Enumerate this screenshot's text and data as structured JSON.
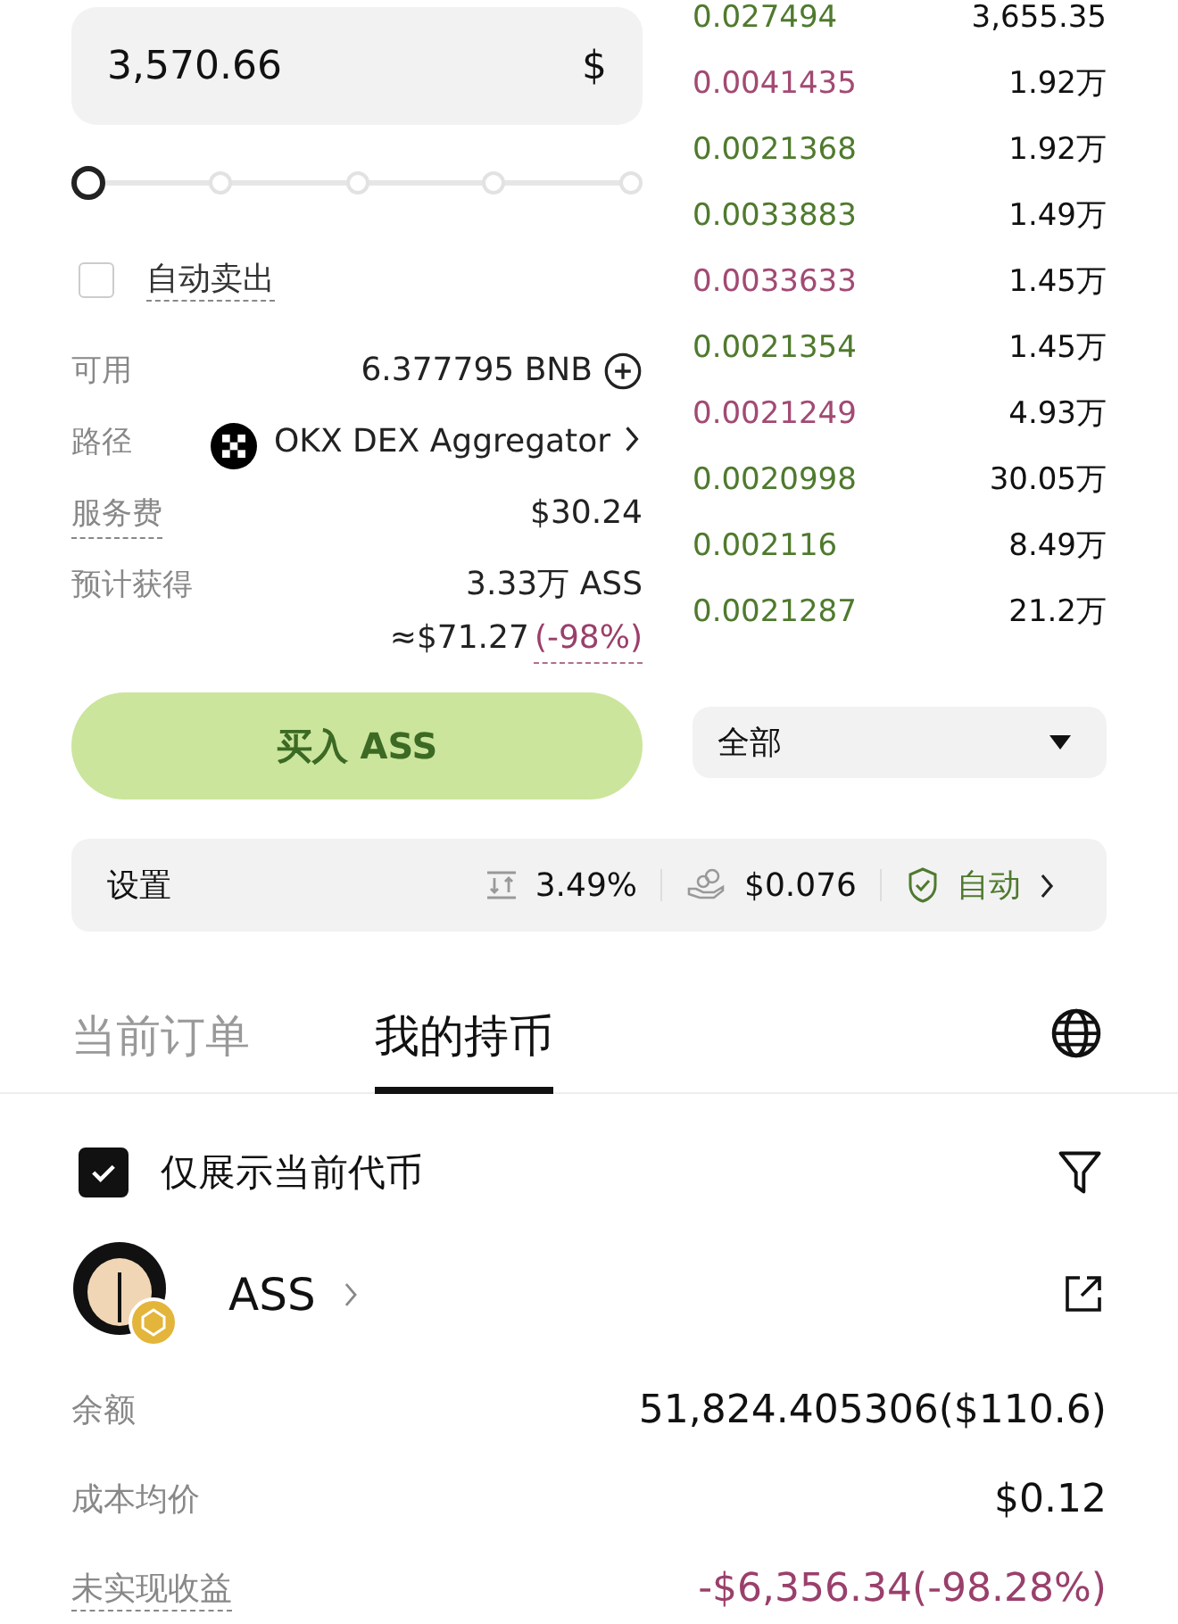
{
  "amount": {
    "value": "3,570.66",
    "unit": "$"
  },
  "slider": {
    "level": 0
  },
  "auto_sell": {
    "label": "自动卖出",
    "checked": false
  },
  "details": [
    {
      "label": "可用",
      "value": "6.377795 BNB",
      "kind": "available"
    },
    {
      "label": "路径",
      "value": "OKX DEX Aggregator",
      "kind": "route"
    },
    {
      "label": "服务费",
      "value": "$30.24",
      "kind": "fee"
    },
    {
      "label": "预计获得",
      "value": "3.33万 ASS",
      "kind": "estimate",
      "sub_value": "≈$71.27",
      "sub_change": "(-98%)"
    }
  ],
  "buy_button": "买入 ASS",
  "trades": [
    {
      "price": "0.027494",
      "amount": "3,655.35",
      "kind": "buy"
    },
    {
      "price": "0.0041435",
      "amount": "1.92万",
      "kind": "sell"
    },
    {
      "price": "0.0021368",
      "amount": "1.92万",
      "kind": "buy"
    },
    {
      "price": "0.0033883",
      "amount": "1.49万",
      "kind": "buy"
    },
    {
      "price": "0.0033633",
      "amount": "1.45万",
      "kind": "sell"
    },
    {
      "price": "0.0021354",
      "amount": "1.45万",
      "kind": "buy"
    },
    {
      "price": "0.0021249",
      "amount": "4.93万",
      "kind": "sell"
    },
    {
      "price": "0.0020998",
      "amount": "30.05万",
      "kind": "buy"
    },
    {
      "price": "0.002116",
      "amount": "8.49万",
      "kind": "buy"
    },
    {
      "price": "0.0021287",
      "amount": "21.2万",
      "kind": "buy"
    }
  ],
  "trade_filter": "全部",
  "settings": {
    "label": "设置",
    "slippage": "3.49%",
    "gas": "$0.076",
    "protection": "自动"
  },
  "tabs": [
    {
      "label": "当前订单",
      "selected": false
    },
    {
      "label": "我的持币",
      "selected": true
    }
  ],
  "only_current": {
    "label": "仅展示当前代币",
    "checked": true
  },
  "holding": {
    "symbol": "ASS",
    "rows": [
      {
        "label": "余额",
        "value": "51,824.405306($110.6)",
        "kind": "plain"
      },
      {
        "label": "成本均价",
        "value": "$0.12",
        "kind": "plain"
      },
      {
        "label": "未实现收益",
        "value": "-$6,356.34(-98.28%)",
        "kind": "pnl"
      }
    ]
  }
}
